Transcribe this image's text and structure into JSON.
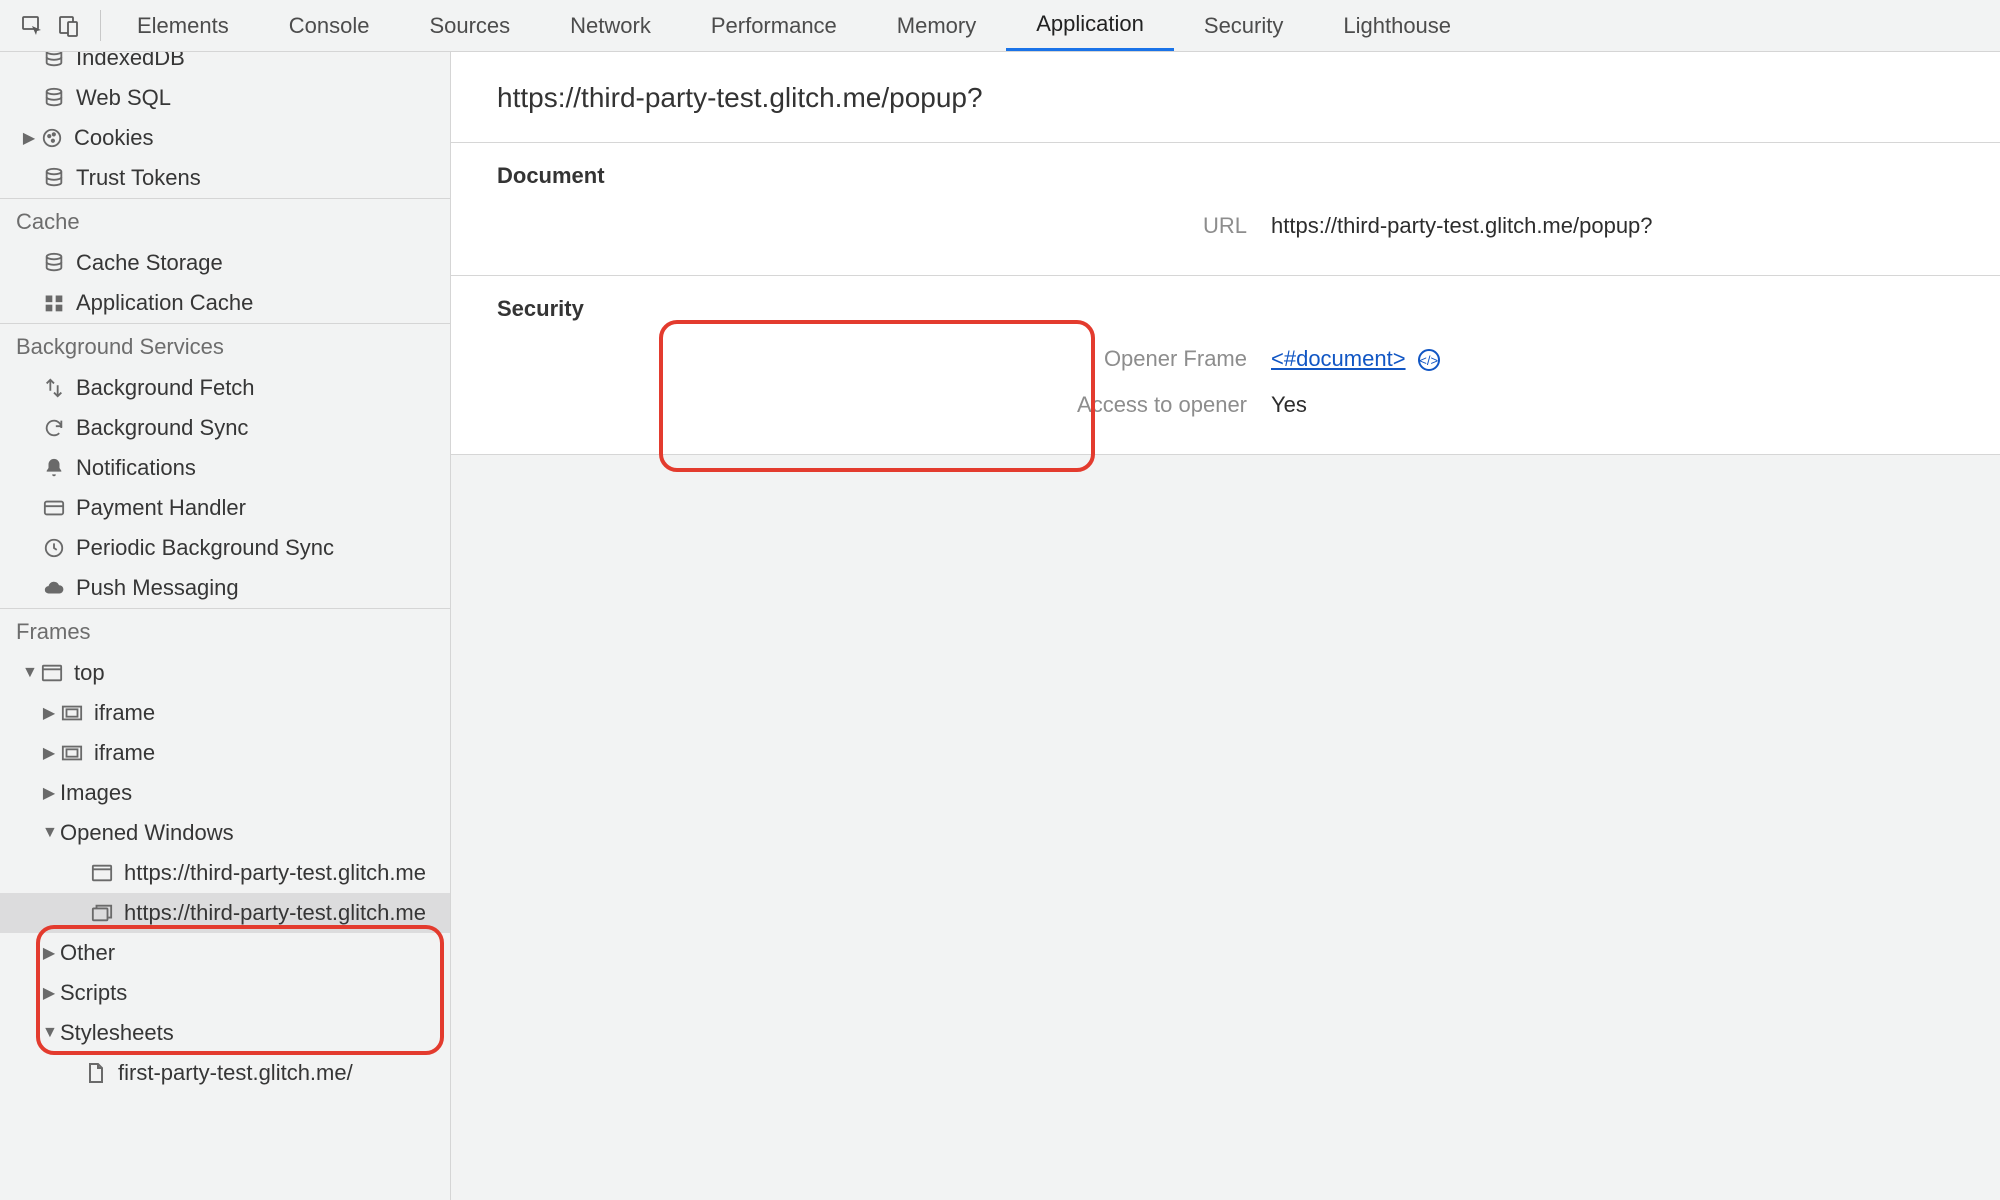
{
  "tabs": {
    "elements": "Elements",
    "console": "Console",
    "sources": "Sources",
    "network": "Network",
    "performance": "Performance",
    "memory": "Memory",
    "application": "Application",
    "security": "Security",
    "lighthouse": "Lighthouse"
  },
  "sidebar": {
    "storage_items": {
      "indexeddb": "IndexedDB",
      "websql": "Web SQL",
      "cookies": "Cookies",
      "trusttokens": "Trust Tokens"
    },
    "cache_header": "Cache",
    "cache_items": {
      "cache_storage": "Cache Storage",
      "application_cache": "Application Cache"
    },
    "bgsvc_header": "Background Services",
    "bgsvc_items": {
      "bg_fetch": "Background Fetch",
      "bg_sync": "Background Sync",
      "notifications": "Notifications",
      "pay_handler": "Payment Handler",
      "periodic_sync": "Periodic Background Sync",
      "push": "Push Messaging"
    },
    "frames_header": "Frames",
    "frames": {
      "top": "top",
      "iframe": "iframe",
      "images": "Images",
      "opened": "Opened Windows",
      "ow1": "https://third-party-test.glitch.me",
      "ow2": "https://third-party-test.glitch.me",
      "other": "Other",
      "scripts": "Scripts",
      "stylesheets": "Stylesheets",
      "leaf": "first-party-test.glitch.me/"
    }
  },
  "detail": {
    "title": "https://third-party-test.glitch.me/popup?",
    "doc_heading": "Document",
    "doc_url_label": "URL",
    "doc_url_value": "https://third-party-test.glitch.me/popup?",
    "sec_heading": "Security",
    "opener_frame_label": "Opener Frame",
    "opener_frame_value": "<#document>",
    "access_label": "Access to opener",
    "access_value": "Yes"
  }
}
